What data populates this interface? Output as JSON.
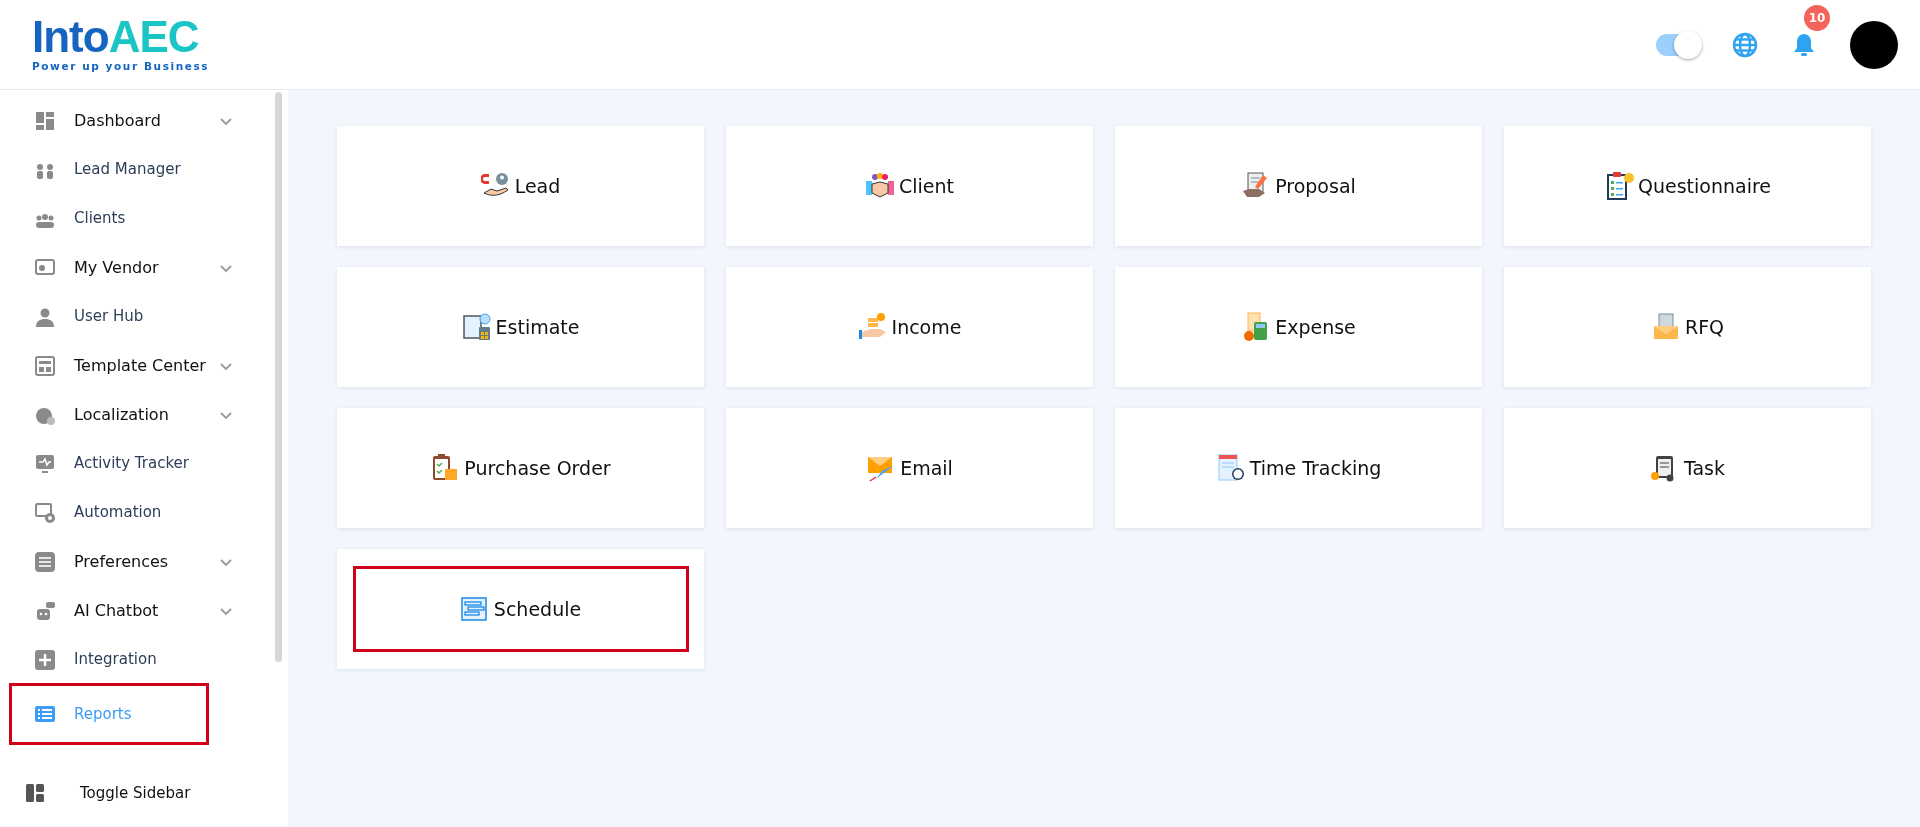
{
  "header": {
    "logo": {
      "name": "IntoAEC",
      "tagline": "Power up your Business"
    },
    "theme_toggle": {
      "on": true
    },
    "notifications": {
      "count": "10"
    }
  },
  "sidebar": {
    "items": [
      {
        "label": "Dashboard",
        "expandable": true,
        "selected": false,
        "highlighted": false
      },
      {
        "label": "Lead Manager",
        "expandable": false,
        "selected": false,
        "highlighted": false
      },
      {
        "label": "Clients",
        "expandable": false,
        "selected": false,
        "highlighted": false
      },
      {
        "label": "My Vendor",
        "expandable": true,
        "selected": false,
        "highlighted": false
      },
      {
        "label": "User Hub",
        "expandable": false,
        "selected": false,
        "highlighted": false
      },
      {
        "label": "Template Center",
        "expandable": true,
        "selected": false,
        "highlighted": false
      },
      {
        "label": "Localization",
        "expandable": true,
        "selected": false,
        "highlighted": false
      },
      {
        "label": "Activity Tracker",
        "expandable": false,
        "selected": false,
        "highlighted": false
      },
      {
        "label": "Automation",
        "expandable": false,
        "selected": false,
        "highlighted": false
      },
      {
        "label": "Preferences",
        "expandable": true,
        "selected": false,
        "highlighted": false
      },
      {
        "label": "AI Chatbot",
        "expandable": true,
        "selected": false,
        "highlighted": false
      },
      {
        "label": "Integration",
        "expandable": false,
        "selected": false,
        "highlighted": false
      },
      {
        "label": "Reports",
        "expandable": false,
        "selected": true,
        "highlighted": true
      }
    ],
    "toggle": {
      "label": "Toggle Sidebar"
    }
  },
  "cards": [
    {
      "label": "Lead",
      "highlighted": false
    },
    {
      "label": "Client",
      "highlighted": false
    },
    {
      "label": "Proposal",
      "highlighted": false
    },
    {
      "label": "Questionnaire",
      "highlighted": false
    },
    {
      "label": "Estimate",
      "highlighted": false
    },
    {
      "label": "Income",
      "highlighted": false
    },
    {
      "label": "Expense",
      "highlighted": false
    },
    {
      "label": "RFQ",
      "highlighted": false
    },
    {
      "label": "Purchase Order",
      "highlighted": false
    },
    {
      "label": "Email",
      "highlighted": false
    },
    {
      "label": "Time Tracking",
      "highlighted": false
    },
    {
      "label": "Task",
      "highlighted": false
    },
    {
      "label": "Schedule",
      "highlighted": true
    }
  ]
}
